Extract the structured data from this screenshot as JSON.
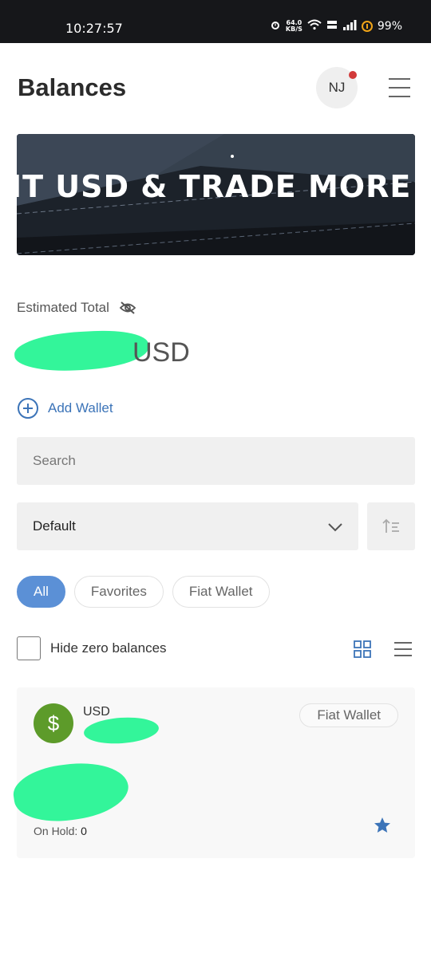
{
  "status_bar": {
    "time": "10:27:57",
    "net_speed_value": "64.0",
    "net_speed_unit": "KB/S",
    "battery": "99%"
  },
  "header": {
    "title": "Balances",
    "avatar_initials": "NJ"
  },
  "banner": {
    "text": "IT USD & TRADE MORE T"
  },
  "estimated": {
    "label": "Estimated Total",
    "currency": "USD"
  },
  "add_wallet": "Add Wallet",
  "search": {
    "placeholder": "Search"
  },
  "sort_select": {
    "value": "Default"
  },
  "filters": [
    "All",
    "Favorites",
    "Fiat Wallet"
  ],
  "hide_zero_label": "Hide zero balances",
  "wallet_card": {
    "coin_symbol": "$",
    "name": "USD",
    "badge": "Fiat Wallet",
    "on_hold_label": "On Hold:",
    "on_hold_value": "0"
  },
  "colors": {
    "accent": "#5b90d6",
    "link": "#3c74b8",
    "coin": "#5d9b2a",
    "redaction": "#33f59a"
  }
}
